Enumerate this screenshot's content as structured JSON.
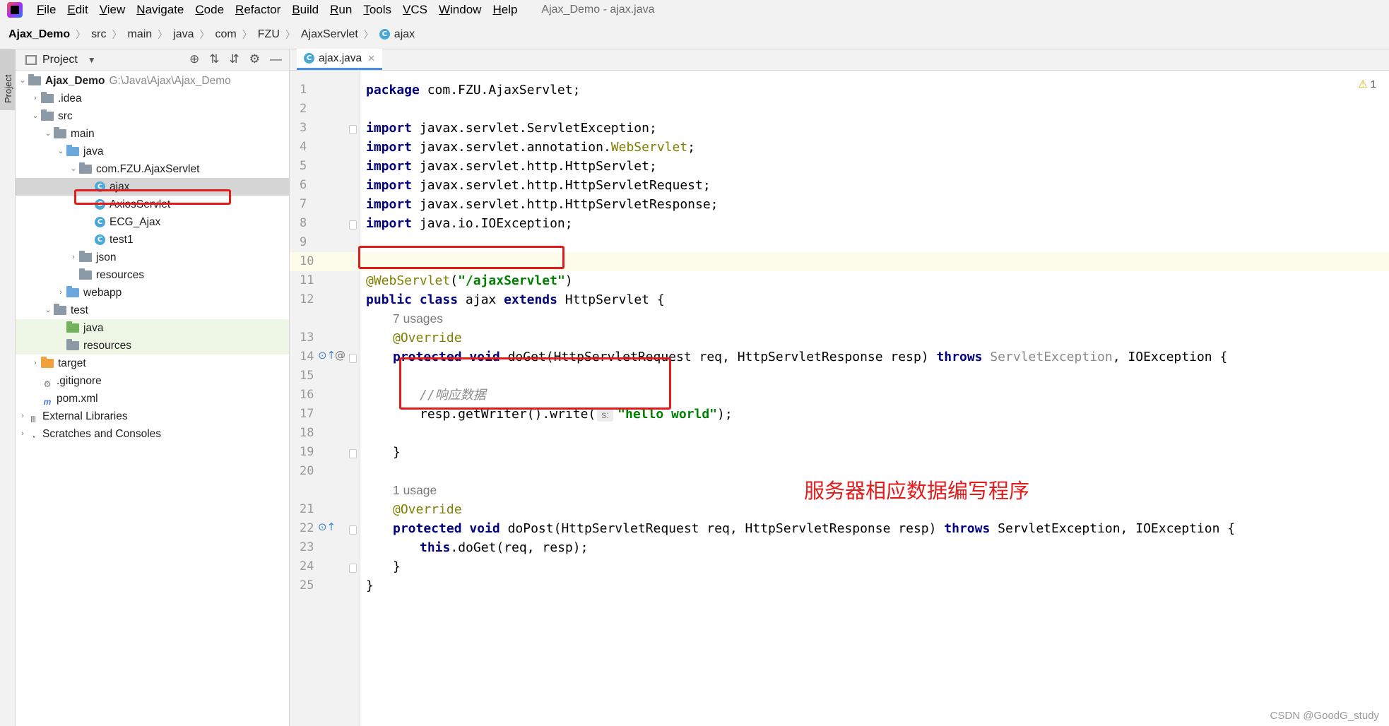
{
  "menubar": {
    "items": [
      {
        "mn": "F",
        "rest": "ile"
      },
      {
        "mn": "E",
        "rest": "dit"
      },
      {
        "mn": "V",
        "rest": "iew"
      },
      {
        "mn": "N",
        "rest": "avigate"
      },
      {
        "mn": "C",
        "rest": "ode"
      },
      {
        "mn": "R",
        "rest": "efactor"
      },
      {
        "mn": "B",
        "rest": "uild"
      },
      {
        "mn": "R",
        "rest": "un"
      },
      {
        "mn": "T",
        "rest": "ools"
      },
      {
        "mn": "V",
        "rest": "CS"
      },
      {
        "mn": "W",
        "rest": "indow"
      },
      {
        "mn": "H",
        "rest": "elp"
      }
    ],
    "window_title": "Ajax_Demo - ajax.java"
  },
  "breadcrumb": {
    "items": [
      "Ajax_Demo",
      "src",
      "main",
      "java",
      "com",
      "FZU",
      "AjaxServlet",
      "ajax"
    ]
  },
  "left_strip": {
    "tab_label": "Project"
  },
  "project_panel": {
    "title": "Project",
    "tree": [
      {
        "label": "Ajax_Demo",
        "note": "G:\\Java\\Ajax\\Ajax_Demo"
      },
      {
        "label": ".idea"
      },
      {
        "label": "src"
      },
      {
        "label": "main"
      },
      {
        "label": "java"
      },
      {
        "label": "com.FZU.AjaxServlet"
      },
      {
        "label": "ajax"
      },
      {
        "label": "AxiosServlet"
      },
      {
        "label": "ECG_Ajax"
      },
      {
        "label": "test1"
      },
      {
        "label": "json"
      },
      {
        "label": "resources"
      },
      {
        "label": "webapp"
      },
      {
        "label": "test"
      },
      {
        "label": "java"
      },
      {
        "label": "resources"
      },
      {
        "label": "target"
      },
      {
        "label": ".gitignore"
      },
      {
        "label": "pom.xml"
      },
      {
        "label": "External Libraries"
      },
      {
        "label": "Scratches and Consoles"
      }
    ]
  },
  "editor": {
    "tab_label": "ajax.java",
    "warning_count": "1",
    "line_numbers": [
      "1",
      "2",
      "3",
      "4",
      "5",
      "6",
      "7",
      "8",
      "9",
      "10",
      "11",
      "12",
      "13",
      "14",
      "15",
      "16",
      "17",
      "18",
      "19",
      "20",
      "21",
      "22",
      "23",
      "24",
      "25"
    ],
    "code": {
      "l1_kw": "package",
      "l1_rest": " com.FZU.AjaxServlet;",
      "import_kw": "import",
      "l3_rest": " javax.servlet.ServletException;",
      "l4_a": " javax.servlet.annotation.",
      "l4_b": "WebServlet",
      "l4_c": ";",
      "l5_rest": " javax.servlet.http.HttpServlet;",
      "l6_rest": " javax.servlet.http.HttpServletRequest;",
      "l7_rest": " javax.servlet.http.HttpServletResponse;",
      "l8_rest": " java.io.IOException;",
      "l11_ann": "@WebServlet",
      "l11_open": "(",
      "l11_str": "\"/ajaxServlet\"",
      "l11_close": ")",
      "l12_public": "public",
      "l12_class": "class",
      "l12_name": " ajax ",
      "l12_extends": "extends",
      "l12_rest": " HttpServlet {",
      "usages_1": "7 usages",
      "override": "@Override",
      "protected": "protected",
      "void": "void",
      "l14_a": " doGet(HttpServletRequest req, HttpServletResponse resp) ",
      "throws": "throws",
      "l14_b": "ServletException",
      "l14_c": ", IOException {",
      "l16_cmt": "//响应数据",
      "l17_a": "resp.getWriter().write(",
      "l17_hint": "s:",
      "l17_str": "\"hello world\"",
      "l17_b": ");",
      "close_brace": "}",
      "usages_2": "1 usage",
      "l22_a": " doPost(HttpServletRequest req, HttpServletResponse resp) ",
      "l22_b": " ServletException, IOException {",
      "this_kw": "this",
      "l23_rest": ".doGet(req, resp);"
    }
  },
  "annotation": "服务器相应数据编写程序",
  "watermark": "CSDN @GoodG_study",
  "colors": {
    "highlight_box": "#e31b1b",
    "keyword": "#000080",
    "string": "#008000",
    "annotation": "#808000"
  }
}
